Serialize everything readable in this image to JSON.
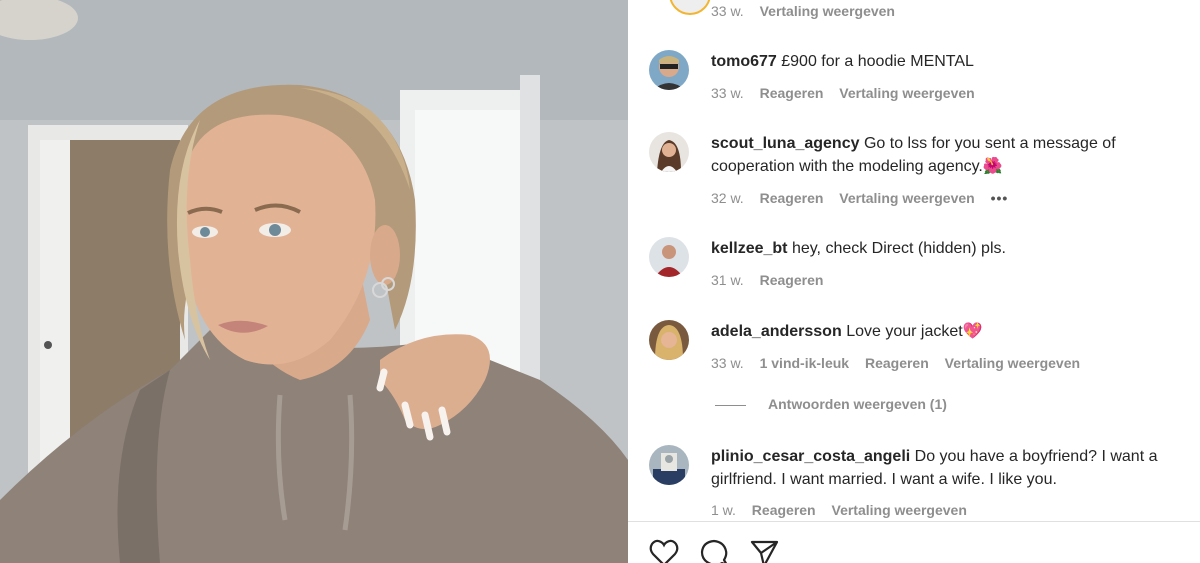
{
  "post": {
    "image_alt": "Portrait of a blonde woman in a taupe hoodie"
  },
  "comments": [
    {
      "time": "33 w.",
      "translate": "Vertaling weergeven"
    },
    {
      "username": "tomo677",
      "text": "£900 for a hoodie MENTAL",
      "time": "33 w.",
      "reply": "Reageren",
      "translate": "Vertaling weergeven"
    },
    {
      "username": "scout_luna_agency",
      "text": "Go to lss for you sent a message of cooperation with the modeling agency.🌺",
      "time": "32 w.",
      "reply": "Reageren",
      "translate": "Vertaling weergeven",
      "more": "•••"
    },
    {
      "username": "kellzee_bt",
      "text": "hey, check Direct (hidden) pls.",
      "time": "31 w.",
      "reply": "Reageren"
    },
    {
      "username": "adela_andersson",
      "text": "Love your jacket💖",
      "time": "33 w.",
      "likes": "1 vind-ik-leuk",
      "reply": "Reageren",
      "translate": "Vertaling weergeven",
      "view_replies": "Antwoorden weergeven (1)"
    },
    {
      "username": "plinio_cesar_costa_angeli",
      "text": "Do you have a boyfriend? I want a girlfriend. I want married. I want a wife. I like you.",
      "time": "1 w.",
      "reply": "Reageren",
      "translate": "Vertaling weergeven"
    }
  ],
  "actions": {
    "icons": [
      "heart-icon",
      "comment-icon",
      "share-icon"
    ]
  }
}
